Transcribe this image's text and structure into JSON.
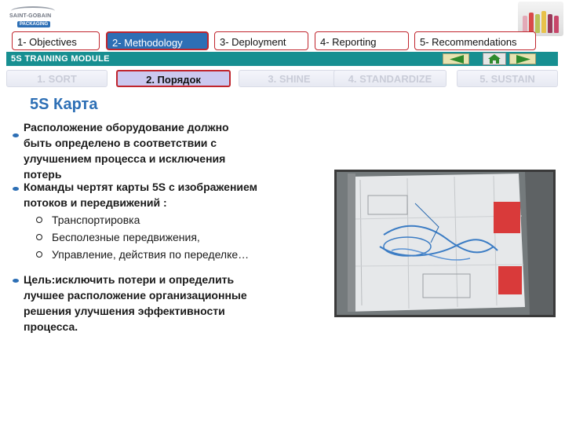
{
  "brand": {
    "name": "SAINT-GOBAIN",
    "sub": "PACKAGING"
  },
  "nav": {
    "tabs": [
      {
        "label": "1- Objectives"
      },
      {
        "label": "2- Methodology"
      },
      {
        "label": "3- Deployment"
      },
      {
        "label": "4- Reporting"
      },
      {
        "label": "5- Recommendations"
      }
    ],
    "active_index": 1
  },
  "module": {
    "title": "5S TRAINING MODULE"
  },
  "controls": {
    "prev_icon": "arrow-left-icon",
    "home_icon": "home-icon",
    "next_icon": "arrow-right-icon"
  },
  "subtabs": {
    "items": [
      {
        "label": "1. SORT"
      },
      {
        "label": "2. Порядок"
      },
      {
        "label": "3. SHINE"
      },
      {
        "label": "4. STANDARDIZE"
      },
      {
        "label": "5. SUSTAIN"
      }
    ],
    "active_index": 1
  },
  "content": {
    "heading": "5S Карта",
    "bullet1_lines": [
      "Расположение оборудование должно",
      "быть определено в соответствии с",
      "улучшением процесса и исключения",
      "потерь"
    ],
    "bullet2_lines": [
      "Команды чертят карты 5S с изображением",
      "потоков и передвижений :"
    ],
    "sub_items": [
      "Транспортировка",
      "Бесполезные передвижения,",
      "Управление, действия по переделке…"
    ],
    "bullet3_lines": [
      "Цель:исключить потери и определить",
      "лучшее расположение организационные",
      "решения улучшения эффективности",
      "процесса."
    ]
  },
  "colors": {
    "accent_blue": "#2d6fb5",
    "border_red": "#c0252d",
    "module_teal": "#178f91",
    "active_subtab": "#cbc8ef"
  }
}
